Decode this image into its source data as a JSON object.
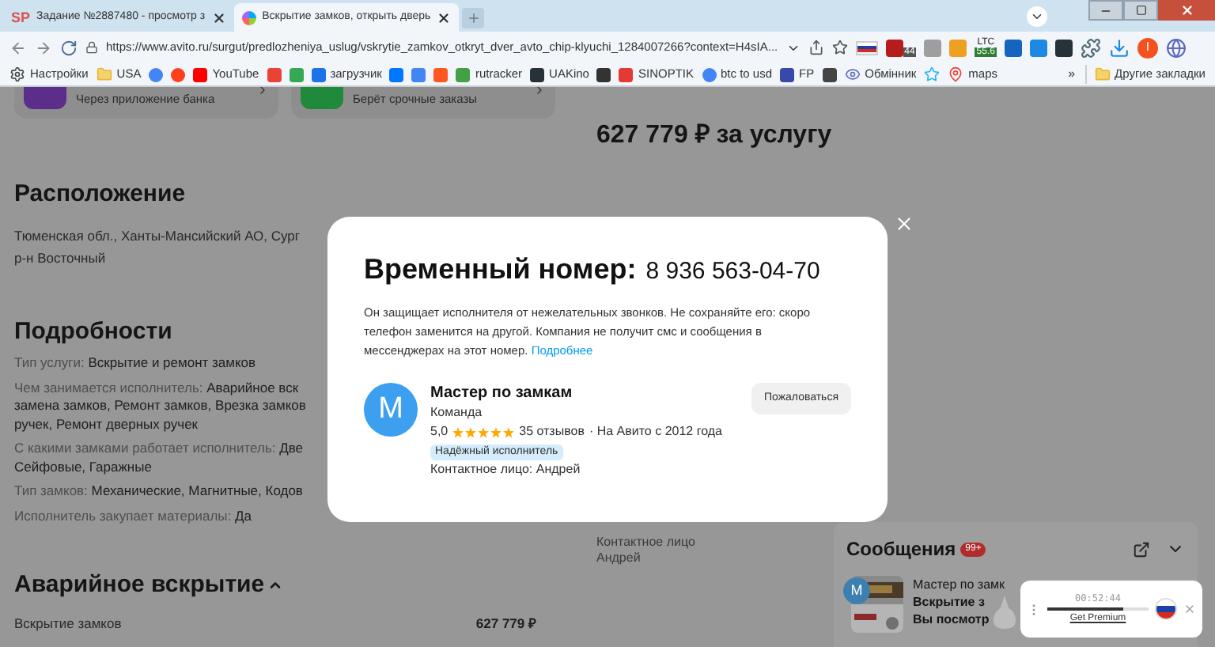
{
  "browser": {
    "tabs": [
      {
        "favicon": "SP",
        "title": "Задание №2887480 - просмотр з",
        "selected": false
      },
      {
        "title": "Вскрытие замков, открыть дверь",
        "selected": true
      }
    ],
    "url": "https://www.avito.ru/surgut/predlozheniya_uslug/vskrytie_zamkov_otkryt_dver_avto_chip-klyuchi_1284007266?context=H4sIA...",
    "extensions": [
      {
        "kind": "flag"
      },
      {
        "kind": "shield",
        "badge": "44"
      },
      {
        "kind": "doc"
      },
      {
        "kind": "coin"
      },
      {
        "kind": "ltc",
        "label": "LTC",
        "badge": "55.6"
      },
      {
        "kind": "v"
      },
      {
        "kind": "download"
      },
      {
        "kind": "terminal"
      },
      {
        "kind": "puzzle"
      },
      {
        "kind": "tray"
      },
      {
        "kind": "avatar",
        "label": "I"
      },
      {
        "kind": "globe"
      }
    ],
    "bookmarks": [
      {
        "kind": "gear",
        "label": "Настройки"
      },
      {
        "kind": "folder",
        "label": "USA"
      },
      {
        "kind": "g"
      },
      {
        "kind": "ya"
      },
      {
        "kind": "youtube",
        "label": "YouTube"
      },
      {
        "kind": "mail"
      },
      {
        "kind": "drive"
      },
      {
        "kind": "loop",
        "label": "загрузчик"
      },
      {
        "kind": "vk"
      },
      {
        "kind": "translate"
      },
      {
        "kind": "f"
      },
      {
        "kind": "flower",
        "label": "rutracker"
      },
      {
        "kind": "dark",
        "label": "UAKino"
      },
      {
        "kind": "chess"
      },
      {
        "kind": "thermo",
        "label": "SINOPTIK"
      },
      {
        "kind": "g",
        "label": "btc to usd"
      },
      {
        "kind": "arrow",
        "label": "FP"
      },
      {
        "kind": "box"
      },
      {
        "kind": "eye",
        "label": "Обмінник"
      },
      {
        "kind": "star"
      },
      {
        "kind": "pin",
        "label": "maps"
      }
    ],
    "more": "»",
    "other_bookmarks": "Другие закладки"
  },
  "page": {
    "cards": [
      {
        "subtitle": "Через приложение банка",
        "color": "#5b2e8c"
      },
      {
        "subtitle": "Берёт срочные заказы",
        "color": "#1f8a3c"
      }
    ],
    "price": "627 779 ₽ за услугу",
    "location": {
      "heading": "Расположение",
      "lines": [
        "Тюменская обл., Ханты-Мансийский АО, Сург",
        "р-н Восточный"
      ]
    },
    "details": {
      "heading": "Подробности",
      "rows": [
        {
          "label": "Тип услуги:",
          "value": "Вскрытие и ремонт замков"
        },
        {
          "label": "Чем занимается исполнитель:",
          "value": "Аварийное вск"
        },
        {
          "value": "замена замков, Ремонт замков, Врезка замков"
        },
        {
          "value": "ручек, Ремонт дверных ручек"
        },
        {
          "label": "С какими замками работает исполнитель:",
          "value": "Две"
        },
        {
          "value": "Сейфовые, Гаражные"
        },
        {
          "label": "Тип замков:",
          "value": "Механические, Магнитные, Кодов"
        },
        {
          "label": "Исполнитель закупает материалы:",
          "value": "Да"
        }
      ]
    },
    "section": {
      "heading": "Аварийное вскрытие",
      "expanded": true,
      "items": [
        {
          "name": "Вскрытие замков",
          "price": "627 779 ₽"
        }
      ]
    },
    "contact": {
      "label": "Контактное лицо",
      "name": "Андрей"
    }
  },
  "modal": {
    "title": "Временный номер:",
    "phone": "8 936 563-04-70",
    "text": "Он защищает исполнителя от нежелательных звонков. Не сохраняйте его: скоро телефон заменится на другой. Компания не получит смс и сообщения в мессенджерах на этот номер.",
    "link": "Подробнее",
    "seller": {
      "avatar": "M",
      "name": "Мастер по замкам",
      "type": "Команда",
      "rating": "5,0",
      "stars": 5,
      "reviews": "35 отзывов",
      "since": "· На Авито с 2012 года",
      "badge": "Надёжный исполнитель",
      "contact": "Контактное лицо: Андрей"
    },
    "report": "Пожаловаться"
  },
  "messages": {
    "title": "Сообщения",
    "badge": "99+",
    "expanded": true,
    "chats": [
      {
        "avatar": "M",
        "lines": [
          "Мастер по замк",
          "Вскрытие з",
          "Вы посмотр"
        ]
      }
    ]
  },
  "widget": {
    "time": "00:52:44",
    "level": 0.75,
    "link": "Get Premium"
  }
}
